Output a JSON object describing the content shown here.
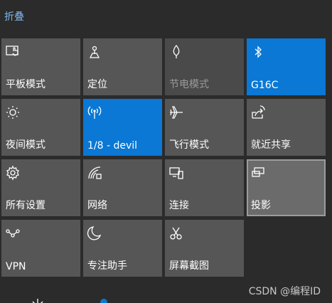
{
  "header": {
    "collapse_label": "折叠"
  },
  "tiles": [
    {
      "label": "平板模式",
      "icon": "tablet-mode-icon",
      "state": "normal"
    },
    {
      "label": "定位",
      "icon": "location-icon",
      "state": "normal"
    },
    {
      "label": "节电模式",
      "icon": "battery-saver-icon",
      "state": "disabled"
    },
    {
      "label": "G16C",
      "icon": "bluetooth-icon",
      "state": "active"
    },
    {
      "label": "夜间模式",
      "icon": "night-light-icon",
      "state": "normal"
    },
    {
      "label": "1/8 - devil",
      "icon": "mobile-hotspot-icon",
      "state": "active"
    },
    {
      "label": "飞行模式",
      "icon": "airplane-icon",
      "state": "normal"
    },
    {
      "label": "就近共享",
      "icon": "nearby-share-icon",
      "state": "normal"
    },
    {
      "label": "所有设置",
      "icon": "gear-icon",
      "state": "normal"
    },
    {
      "label": "网络",
      "icon": "network-icon",
      "state": "normal"
    },
    {
      "label": "连接",
      "icon": "connect-icon",
      "state": "normal"
    },
    {
      "label": "投影",
      "icon": "project-icon",
      "state": "focus"
    },
    {
      "label": "VPN",
      "icon": "vpn-icon",
      "state": "normal"
    },
    {
      "label": "专注助手",
      "icon": "moon-icon",
      "state": "normal"
    },
    {
      "label": "屏幕截图",
      "icon": "screen-snip-icon",
      "state": "normal"
    }
  ],
  "watermark": "CSDN @编程ID",
  "colors": {
    "accent": "#0a78d4",
    "tile": "#565656",
    "background": "#2b2b2b"
  }
}
